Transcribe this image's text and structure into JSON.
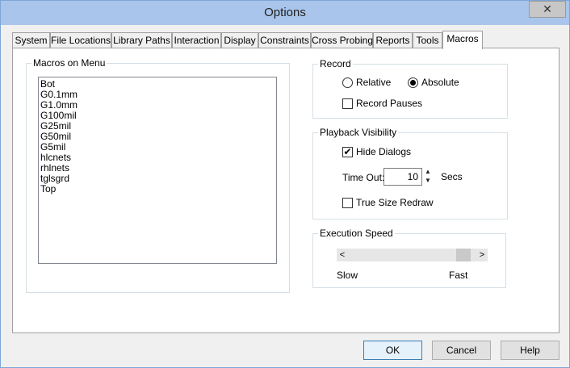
{
  "window": {
    "title": "Options",
    "close_glyph": "✕"
  },
  "tabs": [
    {
      "label": "System"
    },
    {
      "label": "File Locations"
    },
    {
      "label": "Library Paths"
    },
    {
      "label": "Interaction"
    },
    {
      "label": "Display"
    },
    {
      "label": "Constraints"
    },
    {
      "label": "Cross Probing"
    },
    {
      "label": "Reports"
    },
    {
      "label": "Tools"
    },
    {
      "label": "Macros",
      "active": true
    }
  ],
  "macros_group": {
    "label": "Macros on Menu",
    "items": [
      "Bot",
      "G0.1mm",
      "G1.0mm",
      "G100mil",
      "G25mil",
      "G50mil",
      "G5mil",
      "hlcnets",
      "rhlnets",
      "tglsgrd",
      "Top"
    ]
  },
  "record_group": {
    "label": "Record",
    "relative_label": "Relative",
    "absolute_label": "Absolute",
    "selected": "Absolute",
    "record_pauses_label": "Record Pauses",
    "record_pauses_checked": false
  },
  "playback_group": {
    "label": "Playback Visibility",
    "hide_dialogs_label": "Hide Dialogs",
    "hide_dialogs_checked": true,
    "check_glyph": "✔",
    "timeout_label": "Time Out:",
    "timeout_value": "10",
    "timeout_unit": "Secs",
    "true_size_redraw_label": "True Size Redraw",
    "true_size_redraw_checked": false
  },
  "speed_group": {
    "label": "Execution Speed",
    "slow_label": "Slow",
    "fast_label": "Fast",
    "value_fraction": 0.95,
    "left_arrow": "<",
    "right_arrow": ">"
  },
  "buttons": {
    "ok": "OK",
    "cancel": "Cancel",
    "help": "Help"
  }
}
